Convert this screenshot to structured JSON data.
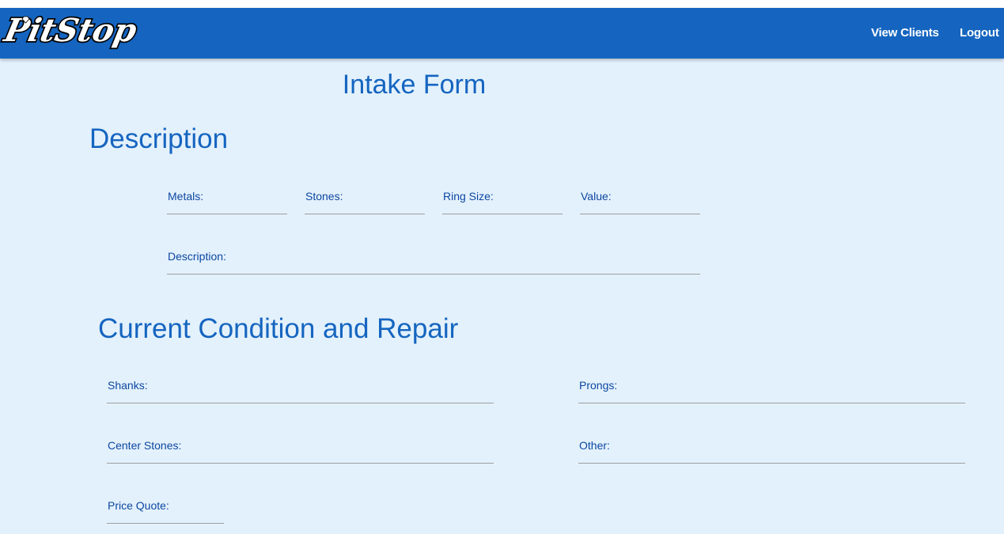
{
  "navbar": {
    "logo_text": "PitStop",
    "links": [
      {
        "label": "View Clients"
      },
      {
        "label": "Logout"
      }
    ]
  },
  "page_title": "Intake Form",
  "description_section": {
    "title": "Description",
    "fields": {
      "metals": {
        "label": "Metals:",
        "value": ""
      },
      "stones": {
        "label": "Stones:",
        "value": ""
      },
      "ring_size": {
        "label": "Ring Size:",
        "value": ""
      },
      "value": {
        "label": "Value:",
        "value": ""
      },
      "description": {
        "label": "Description:",
        "value": ""
      }
    }
  },
  "condition_section": {
    "title": "Current Condition and Repair",
    "fields": {
      "shanks": {
        "label": "Shanks:",
        "value": ""
      },
      "prongs": {
        "label": "Prongs:",
        "value": ""
      },
      "center_stones": {
        "label": "Center Stones:",
        "value": ""
      },
      "other": {
        "label": "Other:",
        "value": ""
      },
      "price_quote": {
        "label": "Price Quote:",
        "value": ""
      }
    }
  },
  "colors": {
    "navbar": "#1565c0",
    "background": "#e3f1fc",
    "heading": "#1565c0",
    "label": "#0d47a1",
    "underline": "#9e9e9e"
  }
}
